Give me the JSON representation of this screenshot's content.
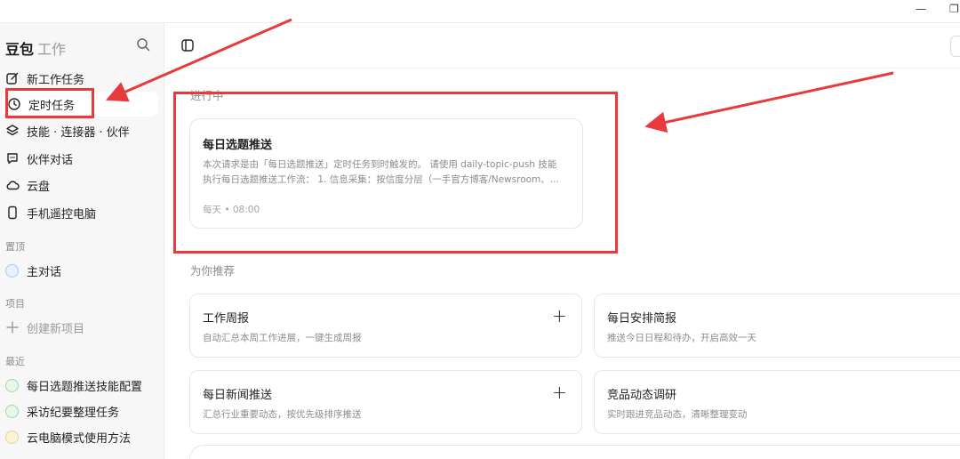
{
  "window": {
    "minimize_glyph": "—",
    "restore_glyph": "❐"
  },
  "sidebar": {
    "brand": "豆包",
    "brand_sub": "工作",
    "search_icon": "search-icon",
    "nav": [
      {
        "label": "新工作任务",
        "icon": "edit-icon"
      },
      {
        "label": "定时任务",
        "icon": "clock-icon"
      },
      {
        "label": "技能 · 连接器 · 伙伴",
        "icon": "layers-icon"
      },
      {
        "label": "伙伴对话",
        "icon": "chat-icon"
      },
      {
        "label": "云盘",
        "icon": "cloud-icon"
      },
      {
        "label": "手机遥控电脑",
        "icon": "phone-icon"
      }
    ],
    "pinned_label": "置顶",
    "pinned": [
      {
        "label": "主对话"
      }
    ],
    "projects_label": "项目",
    "create_project": "创建新项目",
    "recent_label": "最近",
    "recent": [
      {
        "label": "每日选题推送技能配置"
      },
      {
        "label": "采访纪要整理任务"
      },
      {
        "label": "云电脑模式使用方法"
      }
    ]
  },
  "main": {
    "running_label": "进行中",
    "task": {
      "title": "每日选题推送",
      "desc_line1": "本次请求是由「每日选题推送」定时任务到时触发的。 请使用 daily-topic-push 技能",
      "desc_line2": "执行每日选题推送工作流： 1. 信息采集：按信度分层（一手官方博客/Newsroom、...",
      "schedule": "每天 • 08:00"
    },
    "recommend_label": "为你推荐",
    "recommend": [
      {
        "title": "工作周报",
        "desc": "自动汇总本周工作进展，一键生成周报"
      },
      {
        "title": "每日安排简报",
        "desc": "推送今日日程和待办，开启高效一天"
      },
      {
        "title": "每日新闻推送",
        "desc": "汇总行业重要动态，按优先级排序推送"
      },
      {
        "title": "竞品动态调研",
        "desc": "实时跟进竞品动态，清晰整理变动"
      }
    ],
    "plus_glyph": "+"
  },
  "colors": {
    "annotation": "#e8393c",
    "sidebar_bg": "#f7f7f8",
    "muted_text": "#8c8c8c"
  }
}
